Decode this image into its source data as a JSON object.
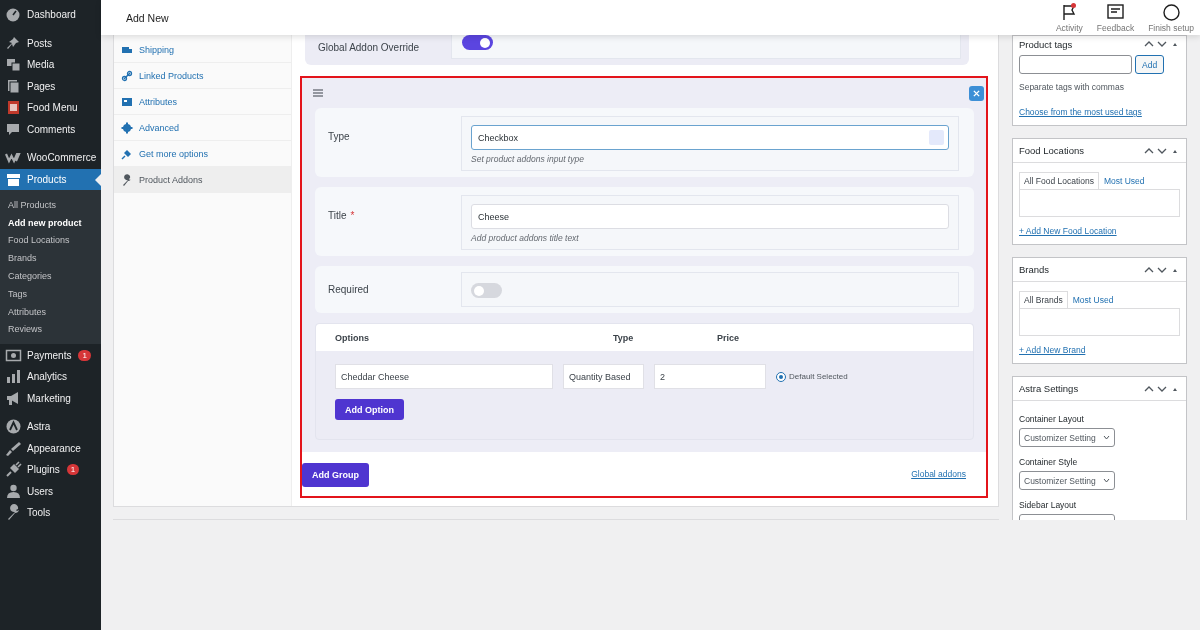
{
  "admin_menu": {
    "sections": [
      {
        "items": [
          {
            "label": "Dashboard",
            "selected": false
          }
        ]
      },
      {
        "items": [
          {
            "label": "Posts",
            "selected": false
          },
          {
            "label": "Media",
            "selected": false
          },
          {
            "label": "Pages",
            "selected": false
          },
          {
            "label": "Food Menu",
            "selected": false
          },
          {
            "label": "Comments",
            "selected": false
          }
        ]
      },
      {
        "items": [
          {
            "label": "WooCommerce",
            "selected": false
          },
          {
            "label": "Products",
            "selected": true,
            "children": [
              {
                "label": "All Products",
                "selected": false
              },
              {
                "label": "Add new product",
                "selected": true
              },
              {
                "label": "Food Locations",
                "selected": false
              },
              {
                "label": "Brands",
                "selected": false
              },
              {
                "label": "Categories",
                "selected": false
              },
              {
                "label": "Tags",
                "selected": false
              },
              {
                "label": "Attributes",
                "selected": false
              },
              {
                "label": "Reviews",
                "selected": false
              }
            ]
          },
          {
            "label": "Payments",
            "selected": false,
            "badge": "1"
          },
          {
            "label": "Analytics",
            "selected": false
          },
          {
            "label": "Marketing",
            "selected": false
          }
        ]
      },
      {
        "items": [
          {
            "label": "Astra",
            "selected": false
          },
          {
            "label": "Appearance",
            "selected": false
          },
          {
            "label": "Plugins",
            "selected": false,
            "badge": "1"
          },
          {
            "label": "Users",
            "selected": false
          },
          {
            "label": "Tools",
            "selected": false
          }
        ]
      }
    ]
  },
  "top_bar": {
    "title": "Add New",
    "actions": [
      {
        "label": "Activity",
        "notification": true
      },
      {
        "label": "Feedback",
        "notification": false
      },
      {
        "label": "Finish setup",
        "notification": false
      }
    ]
  },
  "product_data": {
    "tabs": [
      {
        "label": "Shipping",
        "selected": false
      },
      {
        "label": "Linked Products",
        "selected": false
      },
      {
        "label": "Attributes",
        "selected": false
      },
      {
        "label": "Advanced",
        "selected": false
      },
      {
        "label": "Get more options",
        "selected": false
      },
      {
        "label": "Product Addons",
        "selected": true
      }
    ],
    "global_override": {
      "label": "Global Addon Override",
      "on": true
    },
    "group": {
      "type_field": {
        "label": "Type",
        "value": "Checkbox",
        "hint": "Set product addons input type"
      },
      "title_field": {
        "label": "Title",
        "required_mark": "*",
        "value": "Cheese",
        "hint": "Add product addons title text"
      },
      "required_field": {
        "label": "Required",
        "on": false
      },
      "options_table": {
        "columns": [
          "Options",
          "Type",
          "Price"
        ],
        "rows": [
          {
            "name": "Cheddar Cheese",
            "type": "Quantity Based",
            "price": "2",
            "default_label": "Default Selected",
            "default_selected": true
          }
        ],
        "add_button": "Add Option"
      }
    },
    "add_group_button": "Add Group",
    "global_addons_link": "Global addons"
  },
  "sidebar": {
    "boxes": [
      {
        "kind": "tags",
        "title": "Product tags",
        "add_button": "Add",
        "help": "Separate tags with commas",
        "link": "Choose from the most used tags"
      },
      {
        "kind": "taxonomy",
        "title": "Food Locations",
        "tabs": [
          {
            "label": "All Food Locations",
            "selected": true
          },
          {
            "label": "Most Used",
            "selected": false
          }
        ],
        "link": "+ Add New Food Location"
      },
      {
        "kind": "taxonomy",
        "title": "Brands",
        "tabs": [
          {
            "label": "All Brands",
            "selected": true
          },
          {
            "label": "Most Used",
            "selected": false
          }
        ],
        "link": "+ Add New Brand"
      },
      {
        "kind": "settings",
        "title": "Astra Settings",
        "fields": [
          {
            "label": "Container Layout",
            "value": "Customizer Setting"
          },
          {
            "label": "Container Style",
            "value": "Customizer Setting"
          },
          {
            "label": "Sidebar Layout"
          }
        ]
      }
    ]
  }
}
